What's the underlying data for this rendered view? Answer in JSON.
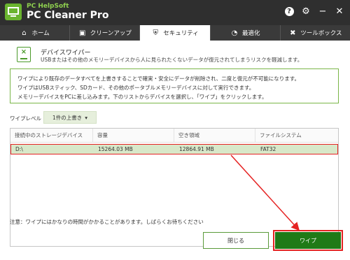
{
  "app": {
    "brand_small": "PC HelpSoft",
    "brand_name": "PC Cleaner Pro"
  },
  "window_controls": [
    {
      "name": "help-icon",
      "glyph": "?"
    },
    {
      "name": "gear-icon",
      "glyph": "⚙"
    },
    {
      "name": "minimize-icon",
      "glyph": "−"
    },
    {
      "name": "close-icon",
      "glyph": "✕"
    }
  ],
  "tabs": [
    {
      "label": "ホーム",
      "icon": "home-icon",
      "active": false
    },
    {
      "label": "クリーンアップ",
      "icon": "cleanup-icon",
      "active": false
    },
    {
      "label": "セキュリティ",
      "icon": "shield-icon",
      "active": true
    },
    {
      "label": "最適化",
      "icon": "speedometer-icon",
      "active": false
    },
    {
      "label": "ツールボックス",
      "icon": "tools-icon",
      "active": false
    }
  ],
  "section": {
    "title": "デバイスワイパー",
    "description": "USBまたはその他のメモリーデバイスから人に見られたくないデータが復元されてしまうリスクを軽減します。"
  },
  "info": {
    "line1": "ワイプにより既存のデータすべてを上書きすることで確実・安全にデータが削除され、二度と復元が不可能になります。",
    "line2": "ワイプはUSBスティック、SDカード、その他のポータブルメモリーデバイスに対して実行できます。",
    "line3": "メモリーデバイスをPCに差し込みます。下のリストからデバイスを選択し、「ワイプ」をクリックします。"
  },
  "wipe_level": {
    "label": "ワイプレベル",
    "selected": "1件の上書き"
  },
  "table": {
    "headers": [
      "接続中のストレージデバイス",
      "容量",
      "空き領域",
      "ファイルシステム"
    ],
    "rows": [
      {
        "device": "D:\\",
        "capacity": "15264.03 MB",
        "free": "12864.91 MB",
        "filesystem": "FAT32"
      }
    ]
  },
  "note": "注意：ワイプにはかなりの時間がかかることがあります。しばらくお待ちください",
  "buttons": {
    "close": "閉じる",
    "wipe": "ワイプ"
  },
  "colors": {
    "accent_green": "#1f7a17",
    "highlight_red": "#e52222",
    "titlebar": "#2f2f2f"
  }
}
